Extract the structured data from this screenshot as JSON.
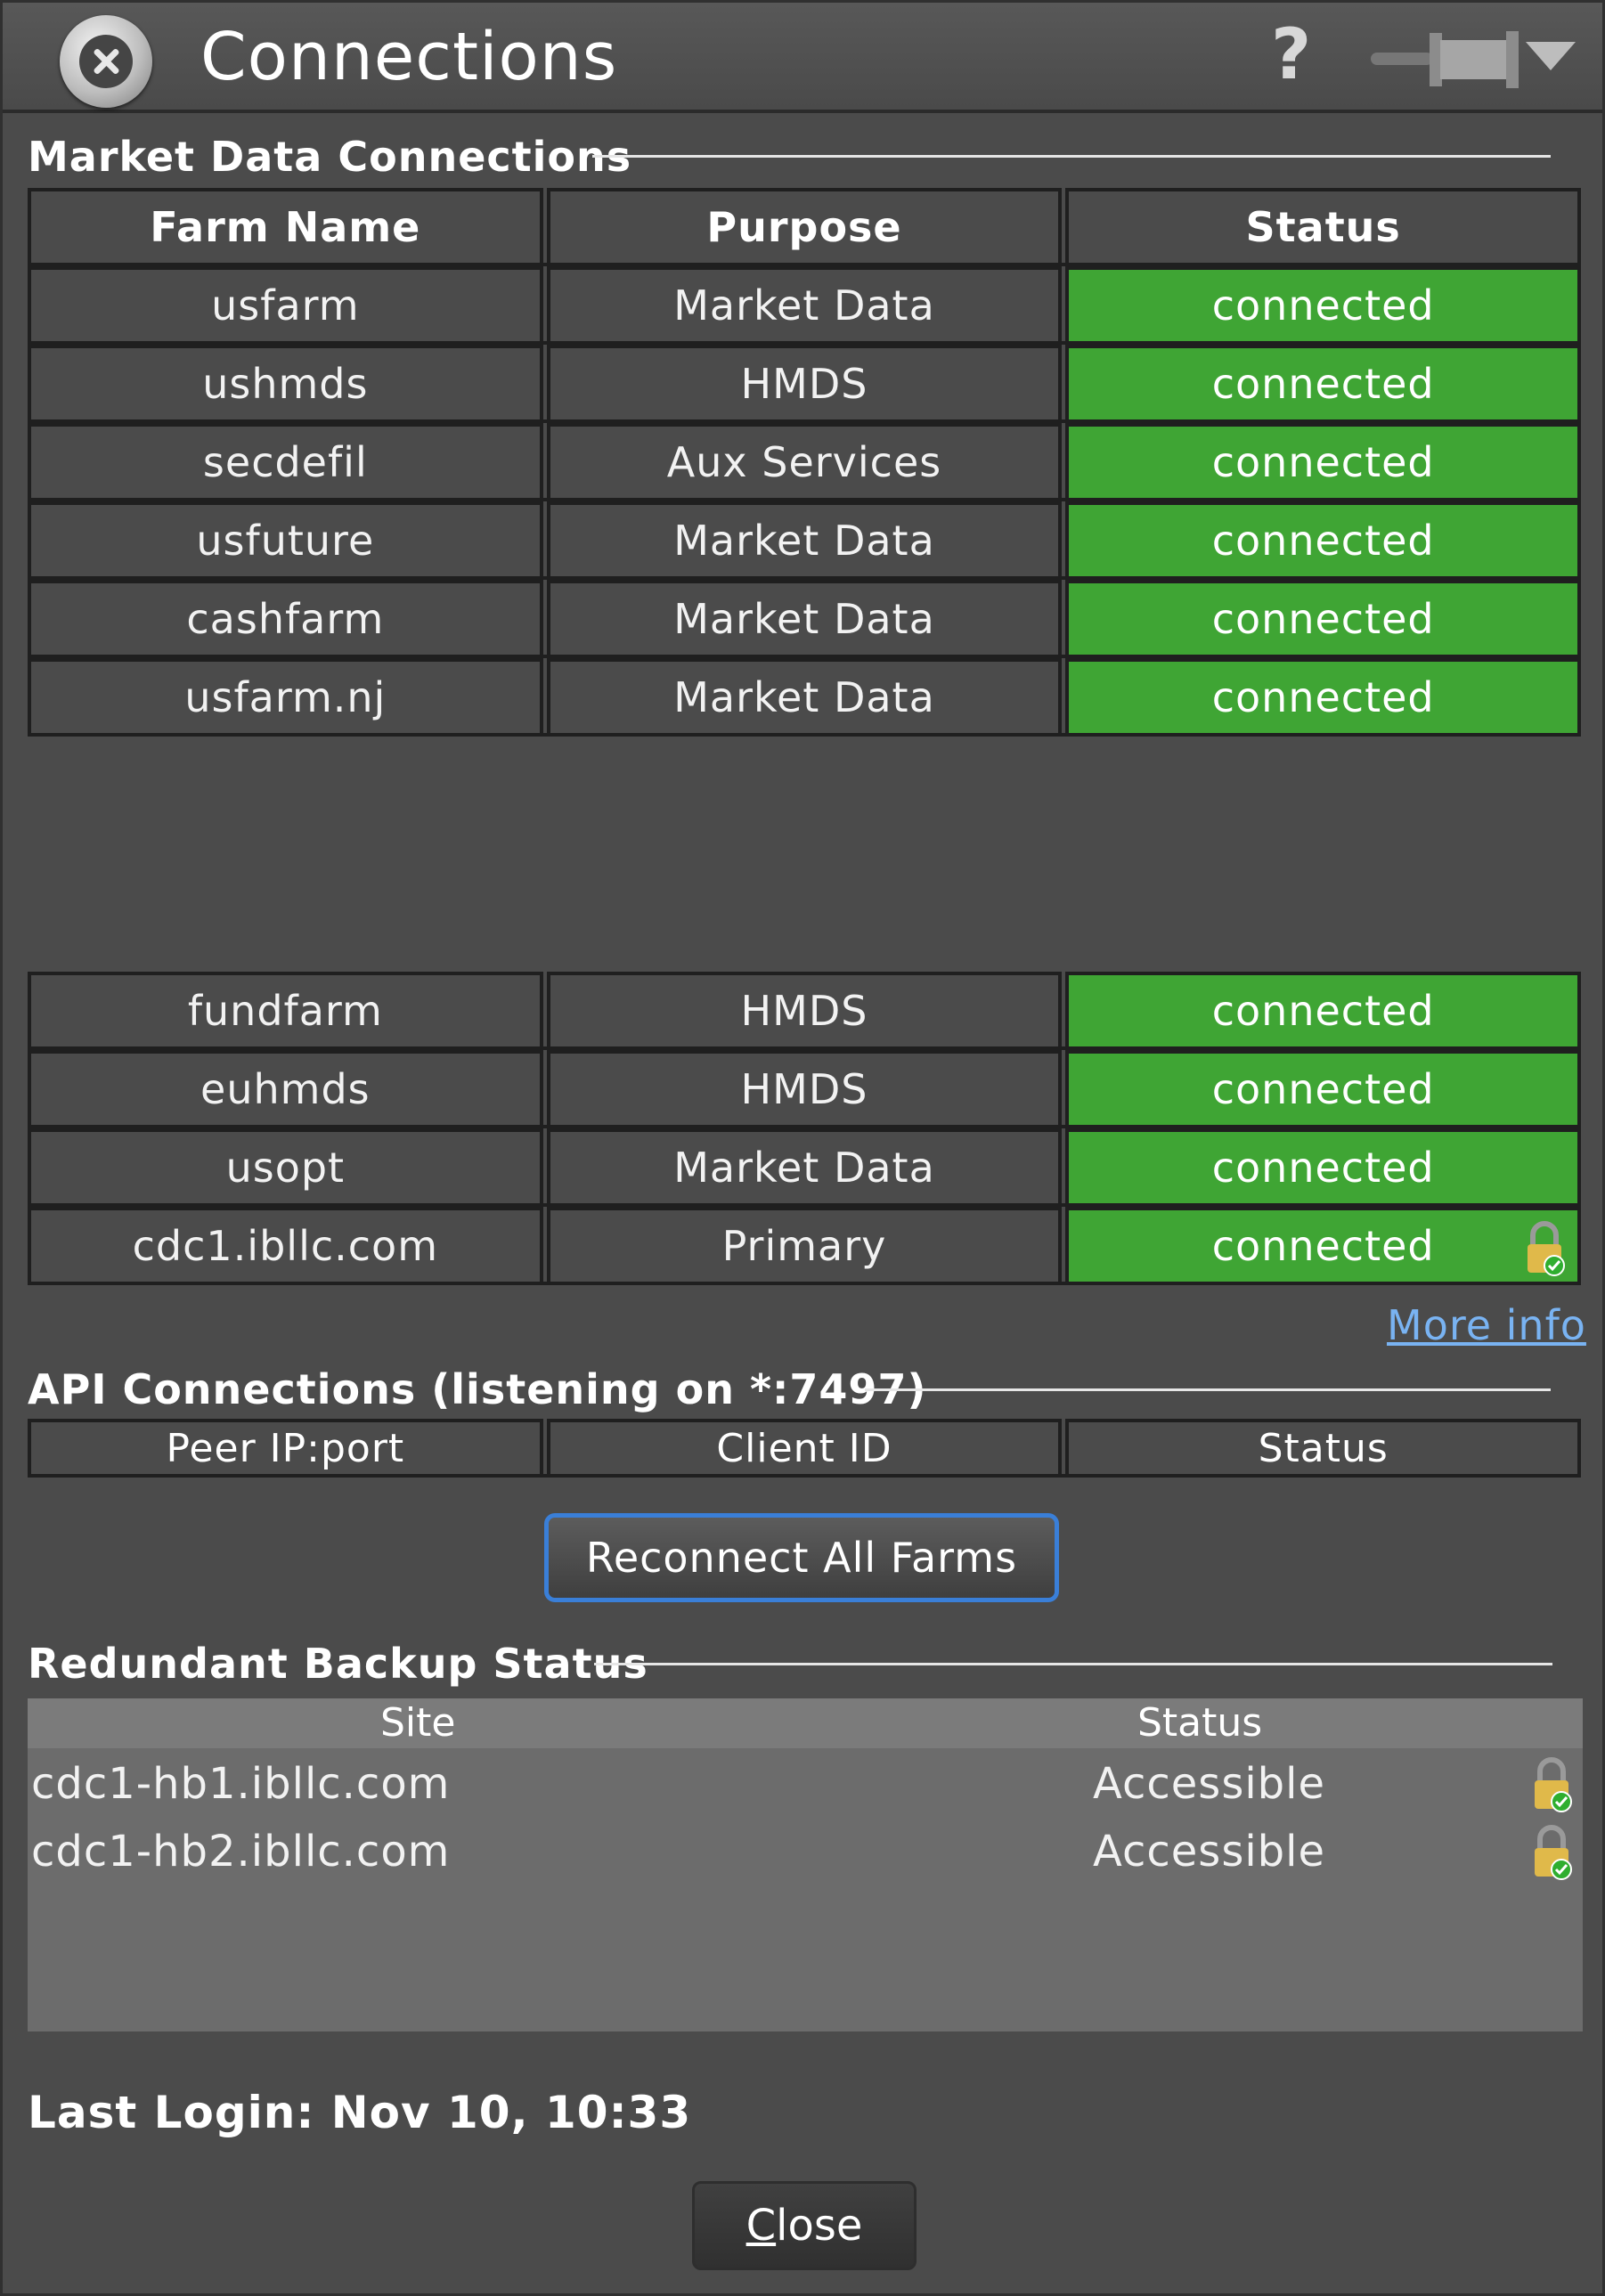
{
  "window": {
    "title": "Connections",
    "help_glyph": "?"
  },
  "market": {
    "heading": "Market Data Connections",
    "headers": [
      "Farm Name",
      "Purpose",
      "Status"
    ],
    "rows_top": [
      {
        "farm": "usfarm",
        "purpose": "Market Data",
        "status": "connected"
      },
      {
        "farm": "ushmds",
        "purpose": "HMDS",
        "status": "connected"
      },
      {
        "farm": "secdefil",
        "purpose": "Aux Services",
        "status": "connected"
      },
      {
        "farm": "usfuture",
        "purpose": "Market Data",
        "status": "connected"
      },
      {
        "farm": "cashfarm",
        "purpose": "Market Data",
        "status": "connected"
      },
      {
        "farm": "usfarm.nj",
        "purpose": "Market Data",
        "status": "connected"
      }
    ],
    "rows_bottom": [
      {
        "farm": "fundfarm",
        "purpose": "HMDS",
        "status": "connected"
      },
      {
        "farm": "euhmds",
        "purpose": "HMDS",
        "status": "connected"
      },
      {
        "farm": "usopt",
        "purpose": "Market Data",
        "status": "connected"
      },
      {
        "farm": "cdc1.ibllc.com",
        "purpose": "Primary",
        "status": "connected",
        "icon": "lock-check-icon"
      }
    ],
    "status_color": "#3fa534",
    "more_info": "More info"
  },
  "api": {
    "heading": "API Connections (listening on *:7497)",
    "headers": [
      "Peer IP:port",
      "Client ID",
      "Status"
    ],
    "reconnect_label": "Reconnect All Farms"
  },
  "backup": {
    "heading": "Redundant Backup Status",
    "headers": [
      "Site",
      "Status"
    ],
    "rows": [
      {
        "site": "cdc1-hb1.ibllc.com",
        "status": "Accessible",
        "icon": "lock-check-icon"
      },
      {
        "site": "cdc1-hb2.ibllc.com",
        "status": "Accessible",
        "icon": "lock-check-icon"
      }
    ]
  },
  "footer": {
    "last_login": "Last Login: Nov 10, 10:33",
    "close_label": "Close"
  },
  "colors": {
    "background": "#4b4b4b",
    "connected_green": "#3fa534",
    "link_blue": "#79b3f2",
    "focus_blue": "#3a7fd8"
  }
}
